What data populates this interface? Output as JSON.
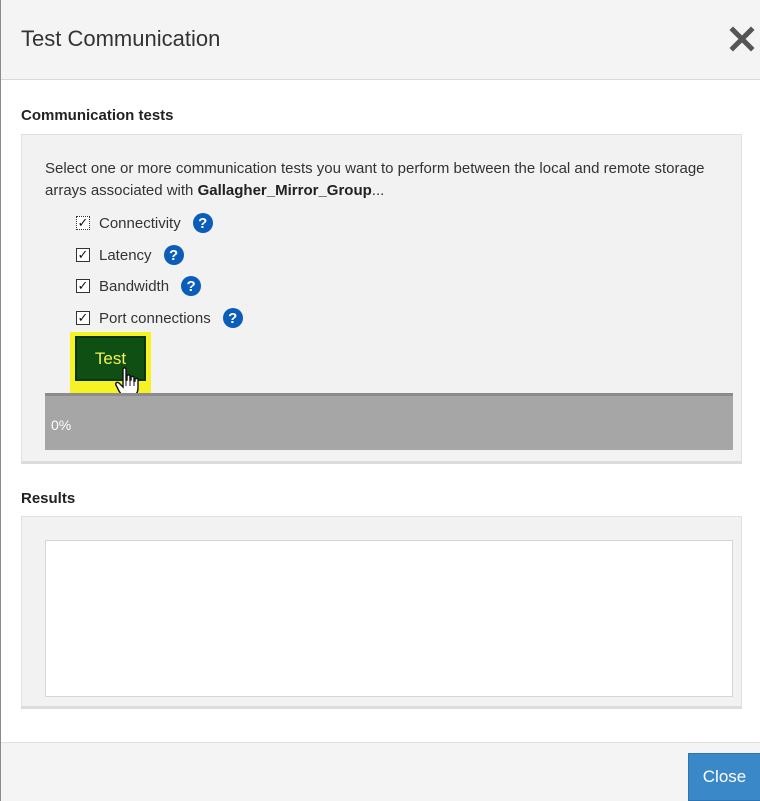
{
  "dialog": {
    "title": "Test Communication"
  },
  "communication_tests": {
    "label": "Communication tests",
    "description_prefix": "Select one or more communication tests you want to perform between the local and remote storage arrays associated with ",
    "group_name": "Gallagher_Mirror_Group",
    "description_suffix": "...",
    "options": [
      {
        "label": "Connectivity",
        "checked": true,
        "help_icon": "question-circle-icon"
      },
      {
        "label": "Latency",
        "checked": true,
        "help_icon": "question-circle-icon"
      },
      {
        "label": "Bandwidth",
        "checked": true,
        "help_icon": "question-circle-icon"
      },
      {
        "label": "Port connections",
        "checked": true,
        "help_icon": "question-circle-icon"
      }
    ],
    "test_button_label": "Test",
    "progress": {
      "value": 0,
      "label": "0%"
    }
  },
  "results": {
    "label": "Results"
  },
  "footer": {
    "close_label": "Close"
  },
  "colors": {
    "help_icon": "#0a5db8",
    "test_button_bg": "#0f4f13",
    "test_button_text": "#f3f05a",
    "highlight": "#f7f223",
    "progress_track": "#a6a6a6",
    "close_button": "#3a88c8"
  }
}
